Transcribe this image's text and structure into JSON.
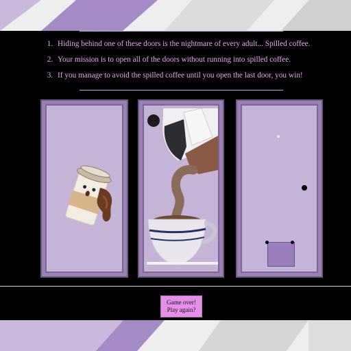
{
  "rules": [
    "Hiding behind one of these doors is the nightmare of every adult... Spilled coffee.",
    "Your mission is to open all of the doors without running into spilled coffee.",
    "If you manage to avoid the spilled coffee until you open the last door, you win!"
  ],
  "doors": [
    {
      "state": "open",
      "content": "spilled-coffee-cup"
    },
    {
      "state": "open",
      "content": "coffee-pouring"
    },
    {
      "state": "closed",
      "content": "closed-door"
    }
  ],
  "button": {
    "line1": "Game over!",
    "line2": "Play again?"
  },
  "colors": {
    "rules_text": "#e8a7f2",
    "door_frame": "#9a80b4",
    "door_panel": "#c5b3d8",
    "button_bg": "#e590e6",
    "background": "#000000"
  }
}
